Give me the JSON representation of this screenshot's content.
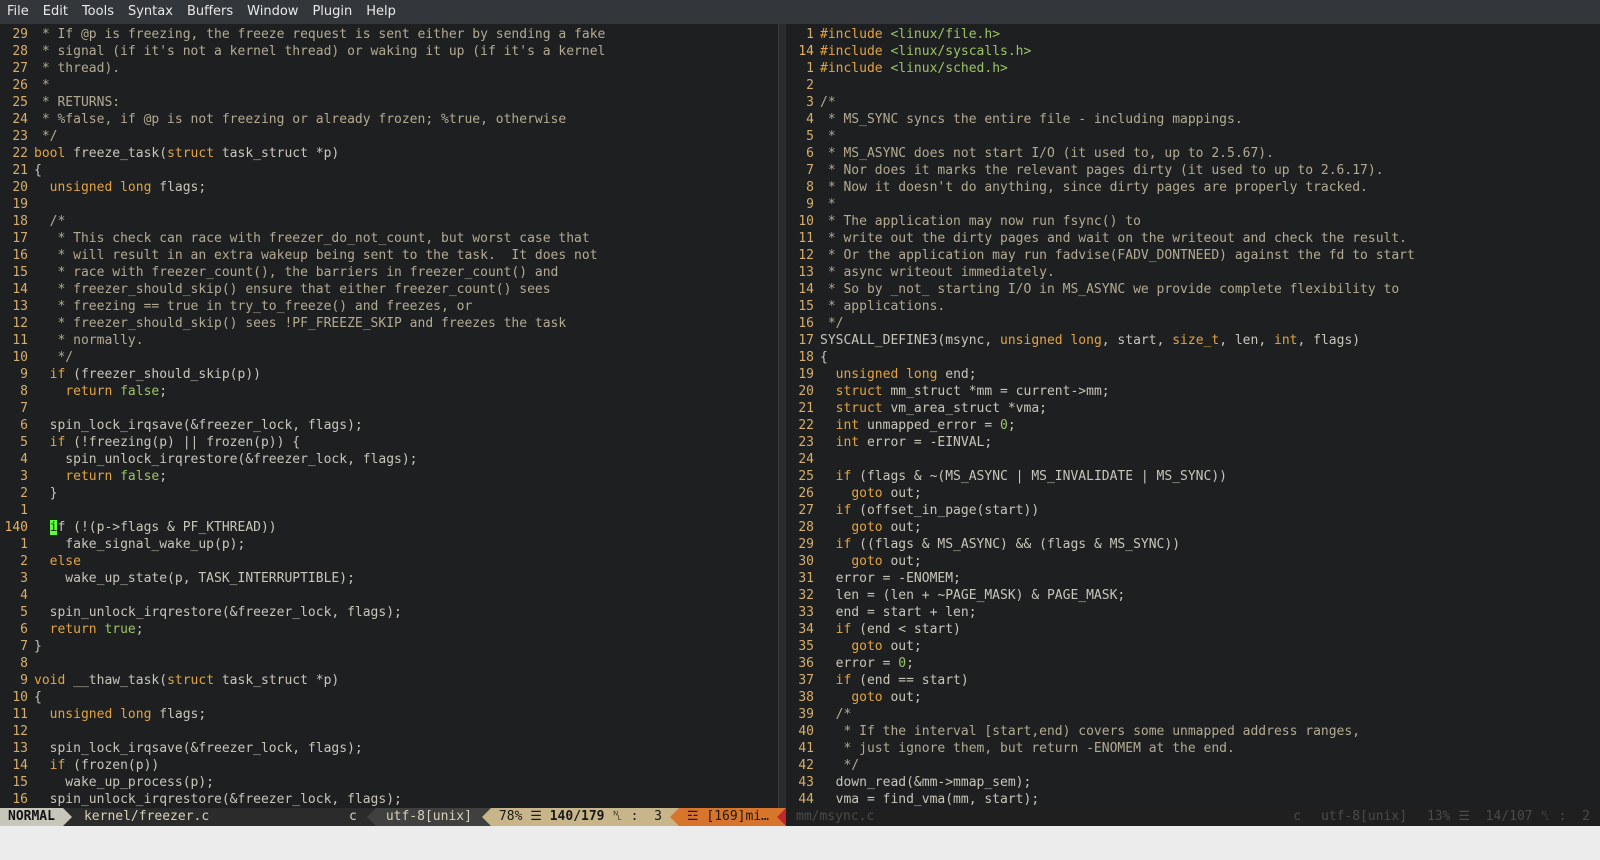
{
  "menu": [
    "File",
    "Edit",
    "Tools",
    "Syntax",
    "Buffers",
    "Window",
    "Plugin",
    "Help"
  ],
  "left_pane": {
    "lines": [
      {
        "n": "29",
        "t": " * If @p is freezing, the freeze request is sent either by sending a fake",
        "c": "cm"
      },
      {
        "n": "28",
        "t": " * signal (if it's not a kernel thread) or waking it up (if it's a kernel",
        "c": "cm"
      },
      {
        "n": "27",
        "t": " * thread).",
        "c": "cm"
      },
      {
        "n": "26",
        "t": " *",
        "c": "cm"
      },
      {
        "n": "25",
        "t": " * RETURNS:",
        "c": "cm"
      },
      {
        "n": "24",
        "t": " * %false, if @p is not freezing or already frozen; %true, otherwise",
        "c": "cm"
      },
      {
        "n": "23",
        "t": " */",
        "c": "cm"
      },
      {
        "n": "22",
        "t": "bool freeze_task(struct task_struct *p)",
        "c": ""
      },
      {
        "n": "21",
        "t": "{",
        "c": ""
      },
      {
        "n": "20",
        "t": "  unsigned long flags;",
        "c": ""
      },
      {
        "n": "19",
        "t": "",
        "c": ""
      },
      {
        "n": "18",
        "t": "  /*",
        "c": "cm"
      },
      {
        "n": "17",
        "t": "   * This check can race with freezer_do_not_count, but worst case that",
        "c": "cm"
      },
      {
        "n": "16",
        "t": "   * will result in an extra wakeup being sent to the task.  It does not",
        "c": "cm"
      },
      {
        "n": "15",
        "t": "   * race with freezer_count(), the barriers in freezer_count() and",
        "c": "cm"
      },
      {
        "n": "14",
        "t": "   * freezer_should_skip() ensure that either freezer_count() sees",
        "c": "cm"
      },
      {
        "n": "13",
        "t": "   * freezing == true in try_to_freeze() and freezes, or",
        "c": "cm"
      },
      {
        "n": "12",
        "t": "   * freezer_should_skip() sees !PF_FREEZE_SKIP and freezes the task",
        "c": "cm"
      },
      {
        "n": "11",
        "t": "   * normally.",
        "c": "cm"
      },
      {
        "n": "10",
        "t": "   */",
        "c": "cm"
      },
      {
        "n": "9",
        "t": "  if (freezer_should_skip(p))",
        "c": ""
      },
      {
        "n": "8",
        "t": "    return false;",
        "c": ""
      },
      {
        "n": "7",
        "t": "",
        "c": ""
      },
      {
        "n": "6",
        "t": "  spin_lock_irqsave(&freezer_lock, flags);",
        "c": ""
      },
      {
        "n": "5",
        "t": "  if (!freezing(p) || frozen(p)) {",
        "c": ""
      },
      {
        "n": "4",
        "t": "    spin_unlock_irqrestore(&freezer_lock, flags);",
        "c": ""
      },
      {
        "n": "3",
        "t": "    return false;",
        "c": ""
      },
      {
        "n": "2",
        "t": "  }",
        "c": ""
      },
      {
        "n": "1",
        "t": "",
        "c": ""
      },
      {
        "n": "140",
        "t": "  if (!(p->flags & PF_KTHREAD))",
        "c": "",
        "cur": true
      },
      {
        "n": "1",
        "t": "    fake_signal_wake_up(p);",
        "c": ""
      },
      {
        "n": "2",
        "t": "  else",
        "c": ""
      },
      {
        "n": "3",
        "t": "    wake_up_state(p, TASK_INTERRUPTIBLE);",
        "c": ""
      },
      {
        "n": "4",
        "t": "",
        "c": ""
      },
      {
        "n": "5",
        "t": "  spin_unlock_irqrestore(&freezer_lock, flags);",
        "c": ""
      },
      {
        "n": "6",
        "t": "  return true;",
        "c": ""
      },
      {
        "n": "7",
        "t": "}",
        "c": ""
      },
      {
        "n": "8",
        "t": "",
        "c": ""
      },
      {
        "n": "9",
        "t": "void __thaw_task(struct task_struct *p)",
        "c": ""
      },
      {
        "n": "10",
        "t": "{",
        "c": ""
      },
      {
        "n": "11",
        "t": "  unsigned long flags;",
        "c": ""
      },
      {
        "n": "12",
        "t": "",
        "c": ""
      },
      {
        "n": "13",
        "t": "  spin_lock_irqsave(&freezer_lock, flags);",
        "c": ""
      },
      {
        "n": "14",
        "t": "  if (frozen(p))",
        "c": ""
      },
      {
        "n": "15",
        "t": "    wake_up_process(p);",
        "c": ""
      },
      {
        "n": "16",
        "t": "  spin_unlock_irqrestore(&freezer_lock, flags);",
        "c": ""
      }
    ]
  },
  "right_pane": {
    "lines": [
      {
        "n": "1",
        "t": "#include <linux/file.h>",
        "c": ""
      },
      {
        "n": "14",
        "t": "#include <linux/syscalls.h>",
        "c": "",
        "cur": true
      },
      {
        "n": "1",
        "t": "#include <linux/sched.h>",
        "c": ""
      },
      {
        "n": "2",
        "t": "",
        "c": ""
      },
      {
        "n": "3",
        "t": "/*",
        "c": "cm"
      },
      {
        "n": "4",
        "t": " * MS_SYNC syncs the entire file - including mappings.",
        "c": "cm"
      },
      {
        "n": "5",
        "t": " *",
        "c": "cm"
      },
      {
        "n": "6",
        "t": " * MS_ASYNC does not start I/O (it used to, up to 2.5.67).",
        "c": "cm"
      },
      {
        "n": "7",
        "t": " * Nor does it marks the relevant pages dirty (it used to up to 2.6.17).",
        "c": "cm"
      },
      {
        "n": "8",
        "t": " * Now it doesn't do anything, since dirty pages are properly tracked.",
        "c": "cm"
      },
      {
        "n": "9",
        "t": " *",
        "c": "cm"
      },
      {
        "n": "10",
        "t": " * The application may now run fsync() to",
        "c": "cm"
      },
      {
        "n": "11",
        "t": " * write out the dirty pages and wait on the writeout and check the result.",
        "c": "cm"
      },
      {
        "n": "12",
        "t": " * Or the application may run fadvise(FADV_DONTNEED) against the fd to start",
        "c": "cm"
      },
      {
        "n": "13",
        "t": " * async writeout immediately.",
        "c": "cm"
      },
      {
        "n": "14",
        "t": " * So by _not_ starting I/O in MS_ASYNC we provide complete flexibility to",
        "c": "cm"
      },
      {
        "n": "15",
        "t": " * applications.",
        "c": "cm"
      },
      {
        "n": "16",
        "t": " */",
        "c": "cm"
      },
      {
        "n": "17",
        "t": "SYSCALL_DEFINE3(msync, unsigned long, start, size_t, len, int, flags)",
        "c": ""
      },
      {
        "n": "18",
        "t": "{",
        "c": ""
      },
      {
        "n": "19",
        "t": "  unsigned long end;",
        "c": ""
      },
      {
        "n": "20",
        "t": "  struct mm_struct *mm = current->mm;",
        "c": ""
      },
      {
        "n": "21",
        "t": "  struct vm_area_struct *vma;",
        "c": ""
      },
      {
        "n": "22",
        "t": "  int unmapped_error = 0;",
        "c": ""
      },
      {
        "n": "23",
        "t": "  int error = -EINVAL;",
        "c": ""
      },
      {
        "n": "24",
        "t": "",
        "c": ""
      },
      {
        "n": "25",
        "t": "  if (flags & ~(MS_ASYNC | MS_INVALIDATE | MS_SYNC))",
        "c": ""
      },
      {
        "n": "26",
        "t": "    goto out;",
        "c": ""
      },
      {
        "n": "27",
        "t": "  if (offset_in_page(start))",
        "c": ""
      },
      {
        "n": "28",
        "t": "    goto out;",
        "c": ""
      },
      {
        "n": "29",
        "t": "  if ((flags & MS_ASYNC) && (flags & MS_SYNC))",
        "c": ""
      },
      {
        "n": "30",
        "t": "    goto out;",
        "c": ""
      },
      {
        "n": "31",
        "t": "  error = -ENOMEM;",
        "c": ""
      },
      {
        "n": "32",
        "t": "  len = (len + ~PAGE_MASK) & PAGE_MASK;",
        "c": ""
      },
      {
        "n": "33",
        "t": "  end = start + len;",
        "c": ""
      },
      {
        "n": "34",
        "t": "  if (end < start)",
        "c": ""
      },
      {
        "n": "35",
        "t": "    goto out;",
        "c": ""
      },
      {
        "n": "36",
        "t": "  error = 0;",
        "c": ""
      },
      {
        "n": "37",
        "t": "  if (end == start)",
        "c": ""
      },
      {
        "n": "38",
        "t": "    goto out;",
        "c": ""
      },
      {
        "n": "39",
        "t": "  /*",
        "c": "cm"
      },
      {
        "n": "40",
        "t": "   * If the interval [start,end) covers some unmapped address ranges,",
        "c": "cm"
      },
      {
        "n": "41",
        "t": "   * just ignore them, but return -ENOMEM at the end.",
        "c": "cm"
      },
      {
        "n": "42",
        "t": "   */",
        "c": "cm"
      },
      {
        "n": "43",
        "t": "  down_read(&mm->mmap_sem);",
        "c": ""
      },
      {
        "n": "44",
        "t": "  vma = find_vma(mm, start);",
        "c": ""
      }
    ]
  },
  "status_left": {
    "mode": "NORMAL",
    "file": "kernel/freezer.c",
    "filetype": "c",
    "encoding": "utf-8[unix]",
    "percent": "78%",
    "position": "140/179",
    "column": "3",
    "warning": "☲ [169]mi…"
  },
  "status_right": {
    "file": "mm/msync.c",
    "filetype": "c",
    "encoding": "utf-8[unix]",
    "percent": "13%",
    "position": "14/107",
    "column": "2"
  },
  "colors": {
    "background": "#1d1f21",
    "keyword": "#e2a442",
    "comment": "#b3aa92",
    "string": "#9dc366",
    "cursor": "#5fff3f",
    "warning": "#d8752c"
  }
}
